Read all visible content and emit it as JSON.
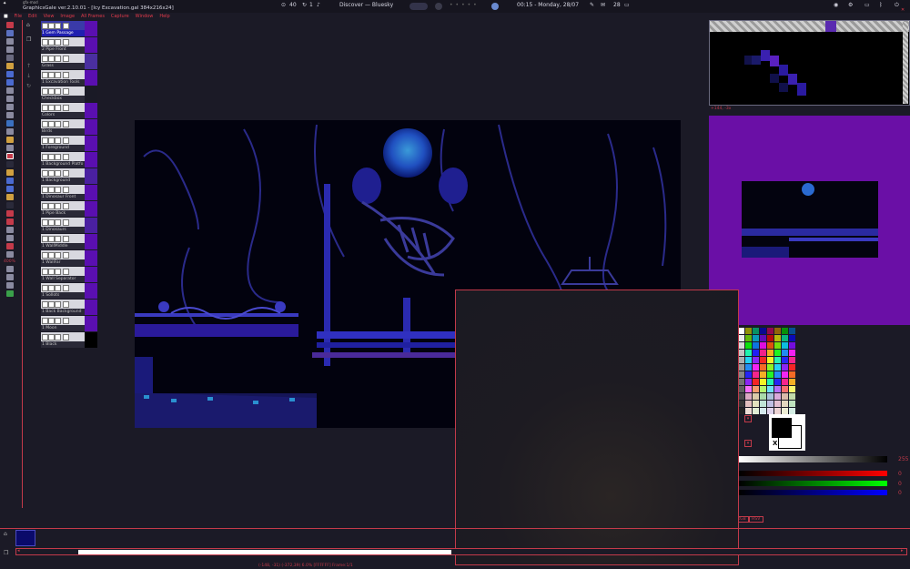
{
  "system_bar": {
    "tray_label": "gfx-mod",
    "window_title": "GraphicsGale ver.2.10.01 - [Icy Excavation.gal 384x216x24]",
    "num_a": "40",
    "num_b": "1",
    "media_title": "Discover — Bluesky",
    "clock": "00:15 - Monday, 28/07",
    "num_c": "28"
  },
  "menu": [
    "File",
    "Edit",
    "View",
    "Image",
    "All Frames",
    "Capture",
    "Window",
    "Help"
  ],
  "layers": [
    {
      "name": "1 Gem Passage",
      "selected": true,
      "thumb": "#5a0fb0"
    },
    {
      "name": "2 Pipe Front",
      "thumb": "#5a0fb0"
    },
    {
      "name": "Grass",
      "thumb": "#4a2fa0"
    },
    {
      "name": "1 Excavation Tools",
      "thumb": "#5a0fb0"
    },
    {
      "name": "Checkbox",
      "thumb": "#1a1a26"
    },
    {
      "name": "Colors",
      "thumb": "#5a0fb0"
    },
    {
      "name": "Birds",
      "thumb": "#5a0fb0"
    },
    {
      "name": "1 Foreground",
      "thumb": "#5a0fb0"
    },
    {
      "name": "1 Background Platfo",
      "thumb": "#5a0fb0"
    },
    {
      "name": "1 Background",
      "thumb": "#4a20a0"
    },
    {
      "name": "1 Dinosaur Front",
      "thumb": "#5a0fb0"
    },
    {
      "name": "1 Pipe Back",
      "thumb": "#5a0fb0"
    },
    {
      "name": "1 Dinosaurs",
      "thumb": "#4a20a0"
    },
    {
      "name": "1 WallMiddle",
      "thumb": "#5a0fb0"
    },
    {
      "name": "1 WallFar",
      "thumb": "#5a0fb0"
    },
    {
      "name": "1 Wall Separator",
      "thumb": "#5a0fb0"
    },
    {
      "name": "1 Sollots",
      "thumb": "#5a0fb0"
    },
    {
      "name": "1 Back Background",
      "thumb": "#5a0fb0"
    },
    {
      "name": "1 Moon",
      "thumb": "#5a0fb0"
    },
    {
      "name": "1 Black",
      "thumb": "#000000"
    }
  ],
  "right_panel": {
    "zoom_label": "+144, -3x",
    "gray_value": "255",
    "r_value": "0",
    "g_value": "0",
    "b_value": "0",
    "x_label": "X",
    "tab_rgb": "RGB",
    "tab_hsv": "HSV"
  },
  "status_bar": "(-148, -31) (-372,39) 6.0% [FFFFFF] Frame:1/1",
  "zoom_percent": "400%",
  "colors": {
    "accent": "#c43a4a",
    "canvas_purple": "#6a0fa6",
    "selection_blue": "#2020b0"
  }
}
